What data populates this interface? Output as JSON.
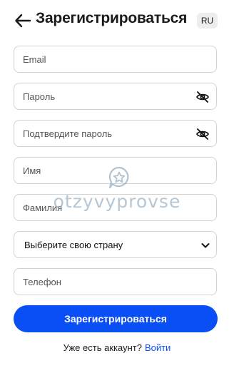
{
  "header": {
    "back_icon": "arrow-left-icon",
    "title": "Зарегистрироваться",
    "lang": "RU"
  },
  "form": {
    "email_placeholder": "Email",
    "password_placeholder": "Пароль",
    "confirm_placeholder": "Подтвердите пароль",
    "first_name_placeholder": "Имя",
    "last_name_placeholder": "Фамилия",
    "country_select": "Выберите свою страну",
    "phone_placeholder": "Телефон",
    "visibility_icon": "eye-off-icon",
    "select_icon": "chevron-down-icon"
  },
  "submit_label": "Зарегистрироваться",
  "footer": {
    "text": "Уже есть аккаунт?",
    "login_label": "Войти"
  },
  "watermark": {
    "text": "otzyvyprovse",
    "icon": "chat-star-icon"
  },
  "colors": {
    "primary": "#0a4ff5",
    "border": "#d3d3d3",
    "badge_bg": "#ededed"
  }
}
